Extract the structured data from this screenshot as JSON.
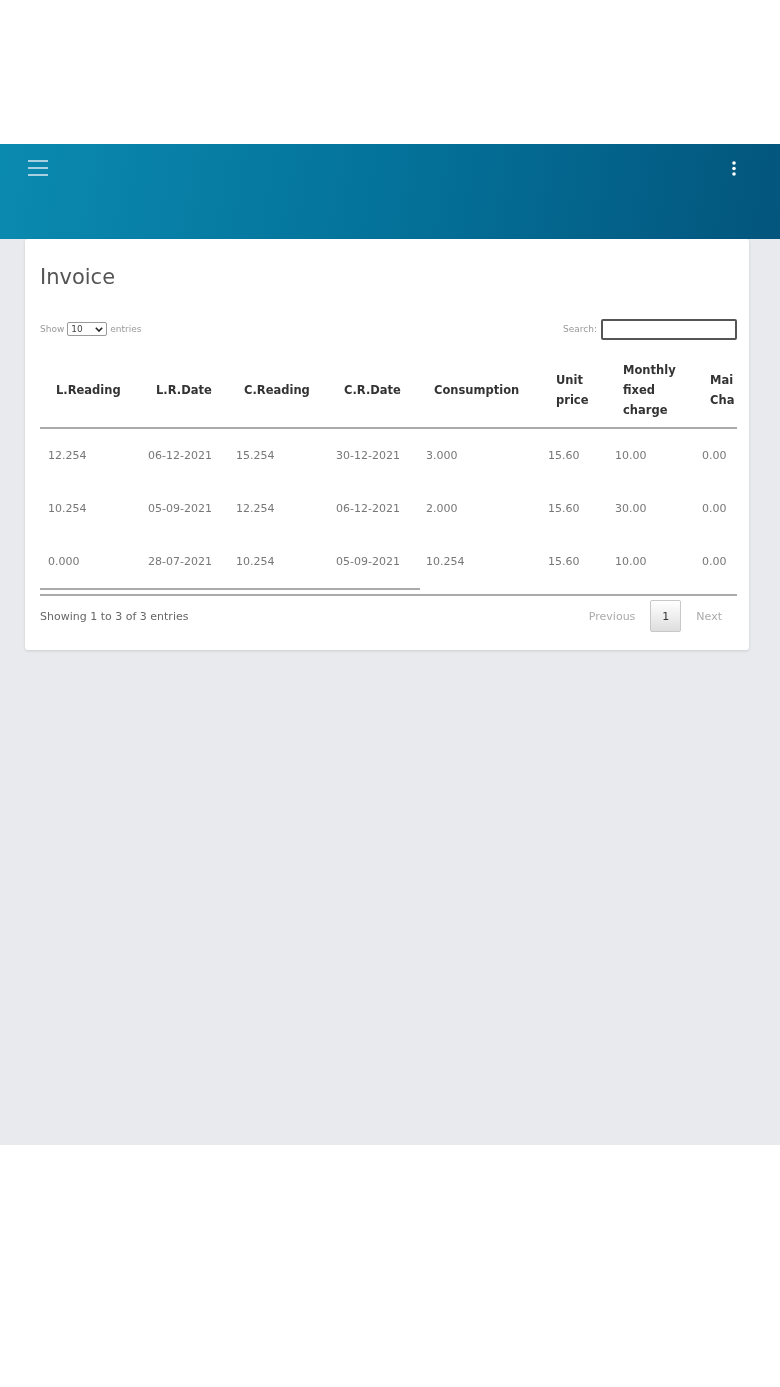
{
  "card": {
    "title": "Invoice",
    "length_menu": {
      "label_before": "Show",
      "value": "10",
      "label_after": "entries"
    },
    "search": {
      "label": "Search:"
    },
    "table": {
      "columns": [
        "L.Reading",
        "L.R.Date",
        "C.Reading",
        "C.R.Date",
        "Consumption",
        "Unit price",
        "Monthly fixed charge",
        "Mai Cha"
      ],
      "rows": [
        [
          "12.254",
          "06-12-2021",
          "15.254",
          "30-12-2021",
          "3.000",
          "15.60",
          "10.00",
          "0.00"
        ],
        [
          "10.254",
          "05-09-2021",
          "12.254",
          "06-12-2021",
          "2.000",
          "15.60",
          "30.00",
          "0.00"
        ],
        [
          "0.000",
          "28-07-2021",
          "10.254",
          "05-09-2021",
          "10.254",
          "15.60",
          "10.00",
          "0.00"
        ]
      ]
    },
    "info": "Showing 1 to 3 of 3 entries",
    "pagination": {
      "previous": {
        "label": "Previous",
        "disabled": true
      },
      "pages": [
        {
          "label": "1",
          "selected": true
        }
      ],
      "next": {
        "label": "Next",
        "disabled": true
      }
    }
  }
}
